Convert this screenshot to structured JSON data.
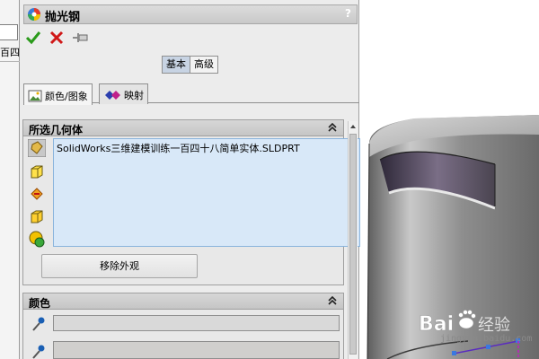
{
  "left_strip": {
    "text": "百四"
  },
  "panel": {
    "title": "抛光钢",
    "help": "?",
    "actions": {
      "ok": "ok",
      "cancel": "cancel",
      "pin": "pin"
    },
    "mode": {
      "basic": "基本",
      "advanced": "高级"
    },
    "tabs": [
      {
        "label": "颜色/图象",
        "icon": "image-icon",
        "active": true
      },
      {
        "label": "映射",
        "icon": "mapping-icon",
        "active": false
      }
    ],
    "selected_geometry": {
      "title": "所选几何体",
      "items": [
        "SolidWorks三维建模训练一百四十八简单实体.SLDPRT"
      ],
      "remove_label": "移除外观",
      "filter_icons": [
        "part-filter-icon",
        "face-filter-icon",
        "feature-filter-icon",
        "body-filter-icon",
        "select-all-icon"
      ]
    },
    "color": {
      "title": "颜色"
    }
  },
  "watermark": {
    "brand": "Bai经验",
    "url": "jingyan.baidu.com"
  },
  "colors": {
    "panel_bg": "#ececec",
    "selection_bg": "#d8e8f8",
    "ok_green": "#2a9a1a",
    "cancel_red": "#d01818",
    "accent_blue": "#1a5fb4"
  }
}
